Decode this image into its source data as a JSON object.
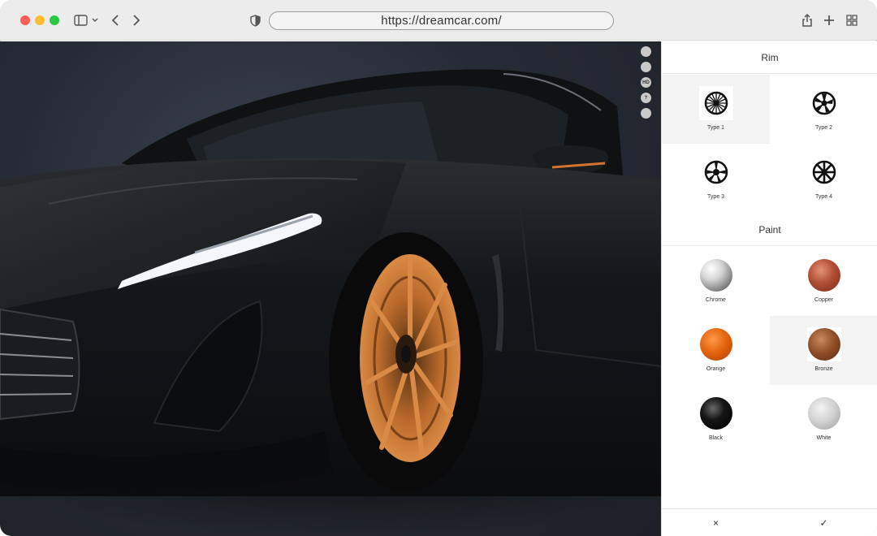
{
  "browser": {
    "url": "https://dreamcar.com/"
  },
  "icons": {
    "sidebar": "sidebar-icon",
    "back": "chevron-left-icon",
    "forward": "chevron-right-icon",
    "privacy": "shield-icon",
    "share": "share-icon",
    "new_tab": "plus-icon",
    "tab_overview": "grid-icon"
  },
  "viewer": {
    "tools": [
      {
        "name": "rotate-icon",
        "glyph": ""
      },
      {
        "name": "reset-icon",
        "glyph": ""
      },
      {
        "name": "hd-icon",
        "glyph": "HD"
      },
      {
        "name": "help-icon",
        "glyph": "?"
      },
      {
        "name": "camera-icon",
        "glyph": ""
      }
    ]
  },
  "panel": {
    "rim_title": "Rim",
    "paint_title": "Paint",
    "rims": [
      {
        "label": "Type 1",
        "selected": true
      },
      {
        "label": "Type 2",
        "selected": false
      },
      {
        "label": "Type 3",
        "selected": false
      },
      {
        "label": "Type 4",
        "selected": false
      }
    ],
    "paints": [
      {
        "label": "Chrome",
        "color": "#c8c8c8",
        "selected": false
      },
      {
        "label": "Copper",
        "color": "#a8462e",
        "selected": false
      },
      {
        "label": "Orange",
        "color": "#e0620c",
        "selected": false
      },
      {
        "label": "Bronze",
        "color": "#8b4a22",
        "selected": true
      },
      {
        "label": "Black",
        "color": "#0c0c0c",
        "selected": false
      },
      {
        "label": "White",
        "color": "#cfcfcf",
        "selected": false
      }
    ],
    "cancel": "×",
    "confirm": "✓"
  },
  "colors": {
    "car_body": "#121416",
    "rim_accent": "#c0702e",
    "headlight": "#f4f6fb"
  }
}
